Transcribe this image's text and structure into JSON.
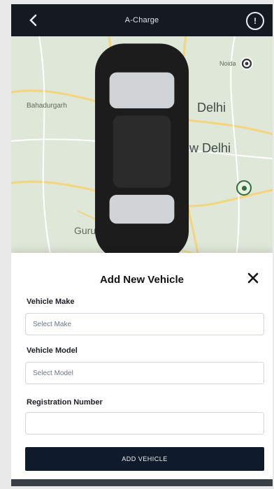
{
  "header": {
    "title": "A-Charge",
    "back_icon": "chevron-left-icon",
    "info_icon": "info-icon"
  },
  "map": {
    "places": [
      "Bahadurgarh",
      "Delhi",
      "New Delhi",
      "Gurugram",
      "Noida"
    ]
  },
  "modal": {
    "title": "Add New Vehicle",
    "vehicle_make_label": "Vehicle Make",
    "vehicle_make_value": "Select Make",
    "vehicle_model_label": "Vehicle Model",
    "vehicle_model_value": "Select Model",
    "registration_label": "Registration Number",
    "registration_placeholder": "",
    "add_button": "ADD VEHICLE"
  },
  "colors": {
    "topbar_bg": "#151a22",
    "button_bg": "#0f1a2b",
    "pin_green": "#2f6c3f"
  }
}
